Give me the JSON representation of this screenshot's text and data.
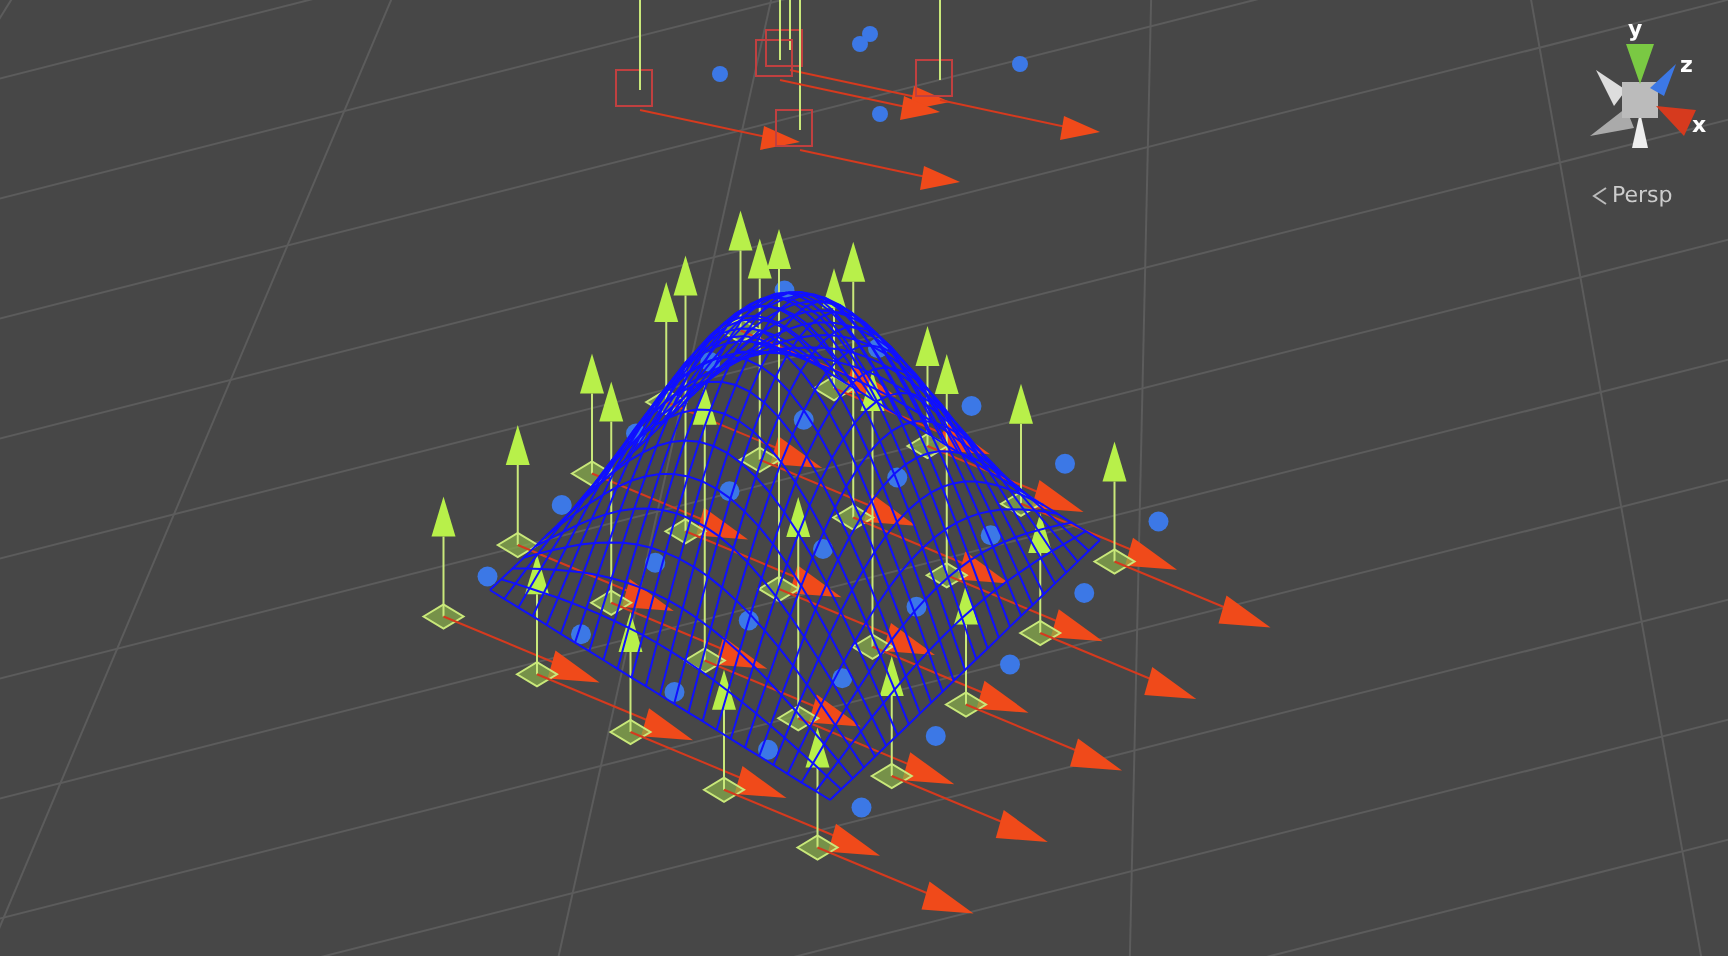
{
  "view": {
    "projection": "Persp"
  },
  "gizmo": {
    "axes": [
      {
        "label": "y",
        "color": "#7ac943"
      },
      {
        "label": "z",
        "color": "#3c78e6"
      },
      {
        "label": "x",
        "color": "#d63a1e"
      }
    ]
  }
}
